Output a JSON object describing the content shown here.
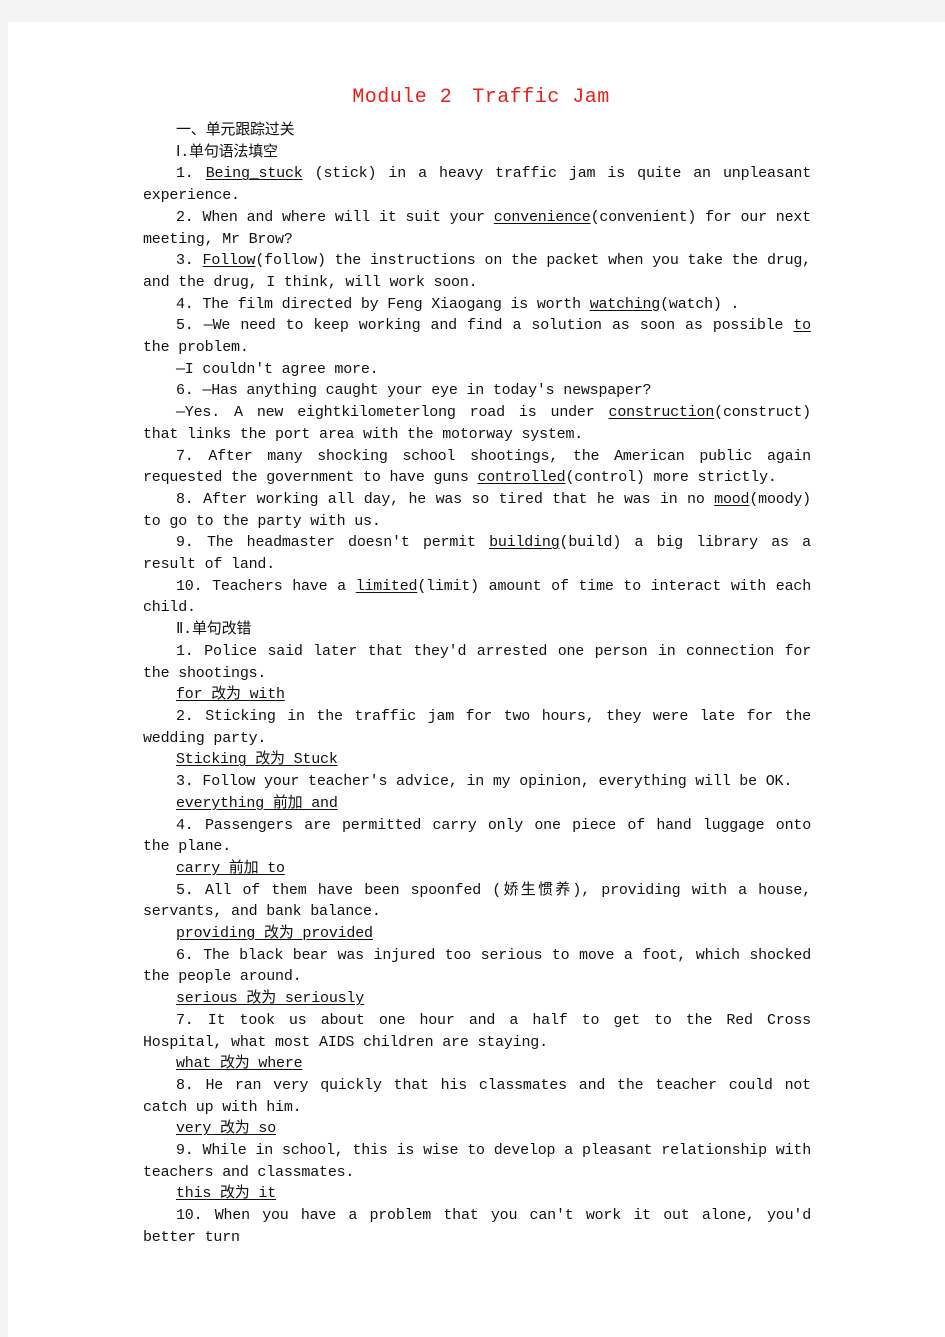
{
  "title": {
    "part1": "Module 2",
    "part2": "Traffic Jam"
  },
  "section_heading": "一、单元跟踪过关",
  "part1": {
    "heading": "Ⅰ.单句语法填空",
    "items": [
      {
        "num": "1.",
        "pre": "",
        "answer": "Being_stuck",
        "post": " (stick) in a heavy traffic jam is quite an unpleasant experience."
      },
      {
        "num": "2.",
        "pre": "When and where will it suit your ",
        "answer": "convenience",
        "post": "(convenient) for our next meeting, Mr Brow?"
      },
      {
        "num": "3.",
        "pre": "",
        "answer": "Follow",
        "post": "(follow) the instructions on the packet when you take the drug, and the drug, I think, will work soon."
      },
      {
        "num": "4.",
        "pre": "The film directed by Feng Xiaogang is worth ",
        "answer": "watching",
        "post": "(watch) ."
      },
      {
        "num": "5.",
        "pre": "—We need to keep working and find a solution as soon as possible ",
        "answer": "to",
        "post": " the problem.",
        "reply": "—I couldn't agree more."
      },
      {
        "num": "6.",
        "pre": "—Has anything caught your eye in today's newspaper?",
        "answer": "",
        "post": "",
        "reply_pre": "—Yes. A new eightkilometerlong road is under  ",
        "reply_answer": "construction",
        "reply_post": "(construct) that links the port area with the motorway system."
      },
      {
        "num": "7.",
        "pre": "After many shocking school shootings, the American public again requested the government to have guns ",
        "answer": "controlled",
        "post": "(control) more strictly."
      },
      {
        "num": "8.",
        "pre": "After working all day, he was so tired that he was in no ",
        "answer": "mood",
        "post": "(moody) to go to the party with us."
      },
      {
        "num": "9.",
        "pre": "The headmaster doesn't permit ",
        "answer": "building",
        "post": "(build) a big library as a result of land."
      },
      {
        "num": "10.",
        "pre": "Teachers have a ",
        "answer": "limited",
        "post": "(limit) amount of time to interact with each child."
      }
    ]
  },
  "part2": {
    "heading": "Ⅱ.单句改错",
    "items": [
      {
        "num": "1.",
        "sentence": "Police said later that they'd arrested one person in connection for the shootings.",
        "correction": "for 改为 with"
      },
      {
        "num": "2.",
        "sentence": "Sticking in the traffic jam for two hours, they were late for the wedding party.",
        "correction": "Sticking 改为 Stuck"
      },
      {
        "num": "3.",
        "sentence": "Follow your teacher's advice, in my opinion, everything will be OK.",
        "correction": "everything 前加 and"
      },
      {
        "num": "4.",
        "sentence": "Passengers are permitted carry only one piece of hand luggage onto the plane.",
        "correction": "carry 前加 to"
      },
      {
        "num": "5.",
        "sentence": "All of them have been spoonfed (娇生惯养), providing with a house, servants, and bank balance.",
        "correction": "providing 改为 provided"
      },
      {
        "num": "6.",
        "sentence": "The black bear was injured too serious to move a foot, which shocked the people around.",
        "correction": "serious 改为 seriously"
      },
      {
        "num": "7.",
        "sentence": "It took us about one hour and a half to get to the Red Cross Hospital, what most AIDS children are staying.",
        "correction": "what 改为 where"
      },
      {
        "num": "8.",
        "sentence": "He ran very quickly that his classmates and the teacher could not catch up with him.",
        "correction": "very 改为 so"
      },
      {
        "num": "9.",
        "sentence": "While in school, this is wise to develop a pleasant relationship with teachers and classmates.",
        "correction": "this 改为 it"
      },
      {
        "num": "10.",
        "sentence": "When you have a problem that you can't work it out alone, you'd better turn",
        "correction": ""
      }
    ]
  }
}
